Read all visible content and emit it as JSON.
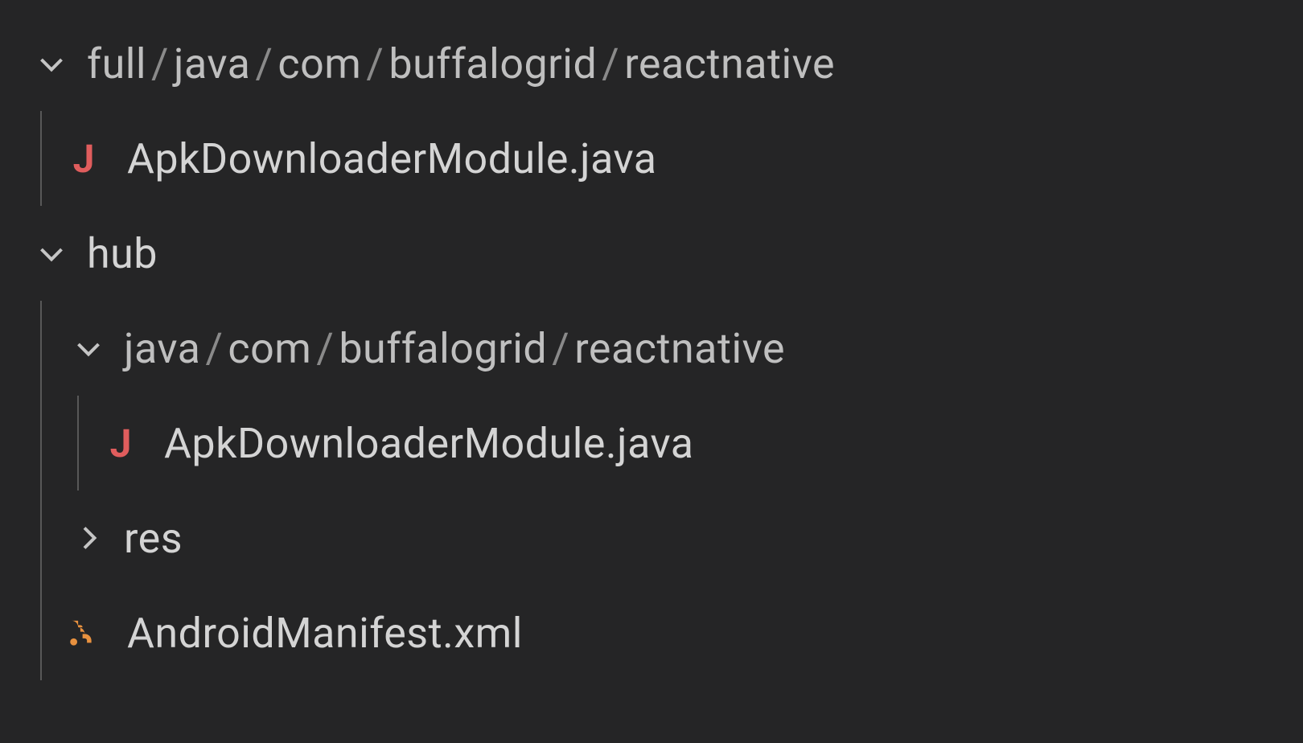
{
  "tree": {
    "row0": {
      "segments": [
        "full",
        "java",
        "com",
        "buffalogrid",
        "reactnative"
      ]
    },
    "row1": {
      "icon_letter": "J",
      "filename": "ApkDownloaderModule.java"
    },
    "row2": {
      "label": "hub"
    },
    "row3": {
      "segments": [
        "java",
        "com",
        "buffalogrid",
        "reactnative"
      ]
    },
    "row4": {
      "icon_letter": "J",
      "filename": "ApkDownloaderModule.java"
    },
    "row5": {
      "label": "res"
    },
    "row6": {
      "filename": "AndroidManifest.xml"
    }
  }
}
